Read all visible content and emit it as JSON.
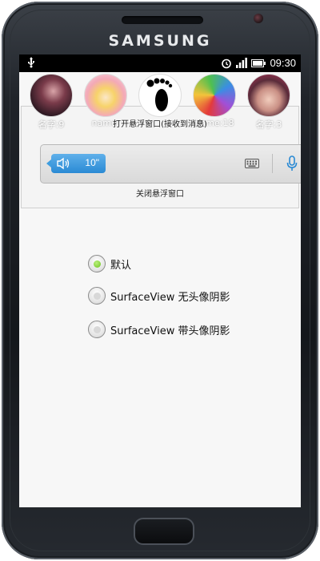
{
  "device": {
    "brand": "SAMSUNG"
  },
  "statusbar": {
    "time": "09:30",
    "icons": [
      "usb-icon",
      "alarm-icon",
      "signal-icon",
      "battery-icon"
    ]
  },
  "floating_window": {
    "open_label": "打开悬浮窗口(接收到消息)",
    "close_label": "关闭悬浮窗口",
    "avatars": [
      {
        "name": "名字:9"
      },
      {
        "name": "name:"
      },
      {
        "name": ""
      },
      {
        "name": "name:18"
      },
      {
        "name": "名字:3"
      }
    ],
    "voice_message": {
      "duration": "10\""
    }
  },
  "radio_group": {
    "options": [
      {
        "label": "默认",
        "checked": true
      },
      {
        "label": "SurfaceView 无头像阴影",
        "checked": false
      },
      {
        "label": "SurfaceView 带头像阴影",
        "checked": false
      }
    ]
  },
  "colors": {
    "accent_blue": "#2a8ad4",
    "radio_checked": "#6dc21f"
  }
}
